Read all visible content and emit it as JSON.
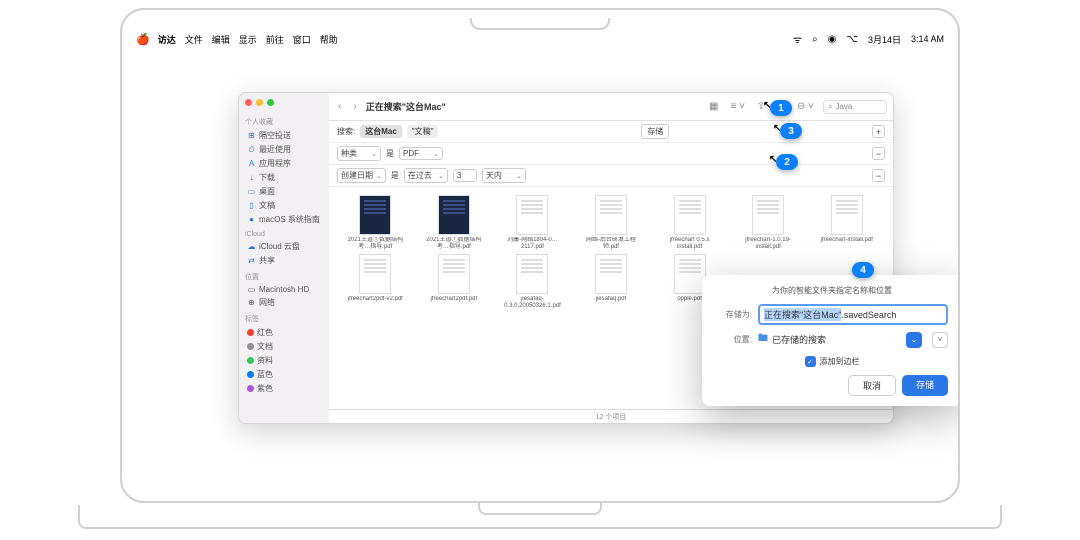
{
  "menubar": {
    "app": "访达",
    "items": [
      "文件",
      "编辑",
      "显示",
      "前往",
      "窗口",
      "帮助"
    ],
    "date": "3月14日",
    "time": "3:14 AM"
  },
  "finder": {
    "title": "正在搜索\"这台Mac\"",
    "search_value": "Java",
    "scope_label": "搜索:",
    "scope_tabs": [
      "这台Mac",
      "\"文稿\""
    ],
    "save_label": "存储",
    "crit1": {
      "kind": "种类",
      "is": "是",
      "val": "PDF"
    },
    "crit2": {
      "date": "创建日期",
      "is": "是",
      "within": "在过去",
      "count": "3",
      "unit": "天内"
    },
    "status": "12 个项目"
  },
  "sidebar": {
    "sections": {
      "fav": "个人收藏",
      "icloud": "iCloud",
      "loc": "位置",
      "tags": "标签"
    },
    "fav": [
      {
        "icon": "⊞",
        "label": "隔空投送"
      },
      {
        "icon": "⏲",
        "label": "最近使用"
      },
      {
        "icon": "A",
        "label": "应用程序"
      },
      {
        "icon": "↓",
        "label": "下载"
      },
      {
        "icon": "▭",
        "label": "桌面"
      },
      {
        "icon": "▯",
        "label": "文稿"
      },
      {
        "icon": "●",
        "label": "macOS 系统指南"
      }
    ],
    "icloud": [
      {
        "icon": "☁",
        "label": "iCloud 云盘"
      },
      {
        "icon": "⇄",
        "label": "共享"
      }
    ],
    "loc": [
      {
        "icon": "▭",
        "label": "Macintosh HD"
      },
      {
        "icon": "⊕",
        "label": "网络"
      }
    ],
    "tags": [
      {
        "color": "#ff3b30",
        "label": "红色"
      },
      {
        "color": "#8e8e93",
        "label": "文档"
      },
      {
        "color": "#34c759",
        "label": "资料"
      },
      {
        "color": "#007aff",
        "label": "蓝色"
      },
      {
        "color": "#af52de",
        "label": "紫色"
      }
    ]
  },
  "files": [
    {
      "name": "2021王道①数据结构考…指导.pdf",
      "blue": true
    },
    {
      "name": "2021王道①数据结构考…指导.pdf",
      "blue": true
    },
    {
      "name": "刘康-网络1804-0…2117.pdf"
    },
    {
      "name": "网络-后台研发工程师.pdf"
    },
    {
      "name": "jfreechart 0.5.x install.pdf"
    },
    {
      "name": "jfreechart-1.0.19-install.pdf"
    },
    {
      "name": "jfreechart-install.pdf"
    },
    {
      "name": "jfreechart2pdf-v2.pdf"
    },
    {
      "name": "jfreechart2pdf.pdf"
    },
    {
      "name": "jiesafaq-0.3.0.20050326.1.pdf"
    },
    {
      "name": "jiesafaq.pdf"
    },
    {
      "name": "opple.pdf"
    }
  ],
  "dialog": {
    "title": "为你的智能文件夹指定名称和位置",
    "name_label": "存储为:",
    "name_value_sel": "正在搜索\"这台Mac\"",
    "name_value_suffix": ".savedSearch",
    "where_label": "位置:",
    "where_value": "已存储的搜索",
    "addsidebar": "添加到边栏",
    "cancel": "取消",
    "save": "存储"
  },
  "callouts": {
    "c1": "1",
    "c2": "2",
    "c3": "3",
    "c4": "4"
  }
}
